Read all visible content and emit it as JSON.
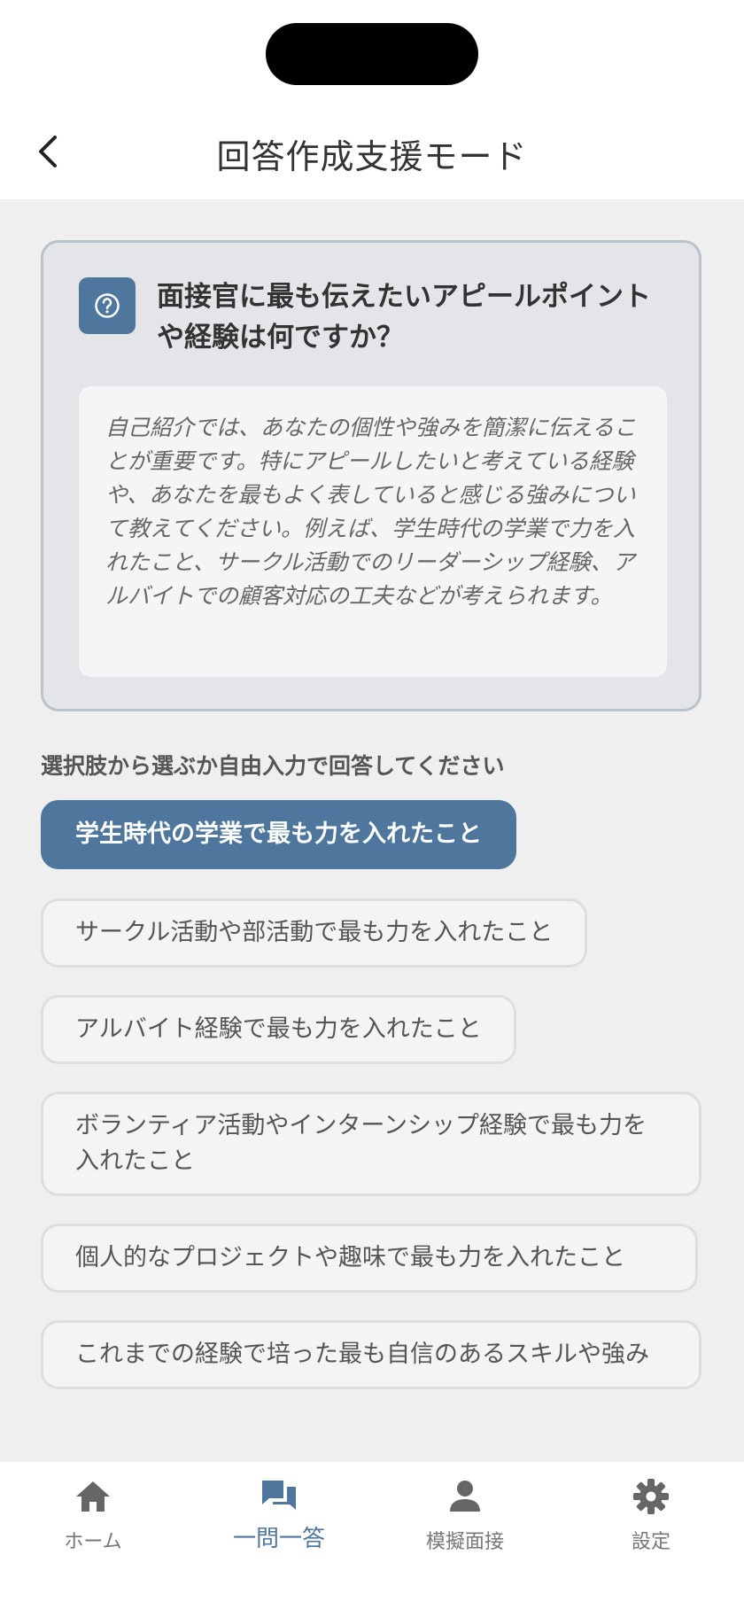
{
  "header": {
    "title": "回答作成支援モード"
  },
  "question": {
    "title": "面接官に最も伝えたいアピールポイントや経験は何ですか？",
    "description": "自己紹介では、あなたの個性や強みを簡潔に伝えることが重要です。特にアピールしたいと考えている経験や、あなたを最もよく表していると感じる強みについて教えてください。例えば、学生時代の学業で力を入れたこと、サークル活動でのリーダーシップ経験、アルバイトでの顧客対応の工夫などが考えられます。"
  },
  "prompt": "選択肢から選ぶか自由入力で回答してください",
  "options": [
    {
      "label": "学生時代の学業で最も力を入れたこと",
      "selected": true
    },
    {
      "label": "サークル活動や部活動で最も力を入れたこと",
      "selected": false
    },
    {
      "label": "アルバイト経験で最も力を入れたこと",
      "selected": false
    },
    {
      "label": "ボランティア活動やインターンシップ経験で最も力を入れたこと",
      "selected": false
    },
    {
      "label": "個人的なプロジェクトや趣味で最も力を入れたこと",
      "selected": false
    },
    {
      "label": "これまでの経験で培った最も自信のあるスキルや強み",
      "selected": false
    }
  ],
  "nav": {
    "items": [
      {
        "label": "ホーム",
        "icon": "home-icon"
      },
      {
        "label": "一問一答",
        "icon": "chat-icon",
        "active": true
      },
      {
        "label": "模擬面接",
        "icon": "person-icon"
      },
      {
        "label": "設定",
        "icon": "gear-icon"
      }
    ]
  },
  "colors": {
    "accent": "#4f769c",
    "background": "#efefef",
    "card": "#e3e5e8"
  }
}
